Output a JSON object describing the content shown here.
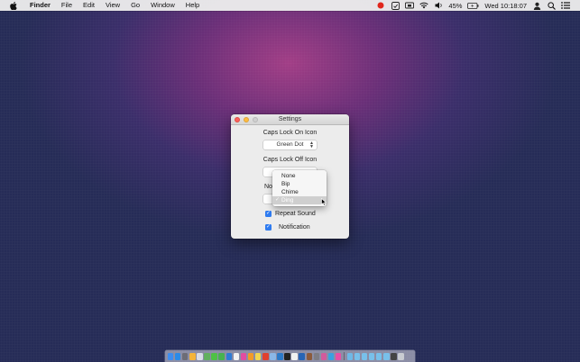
{
  "menubar": {
    "app_name": "Finder",
    "items": [
      "File",
      "Edit",
      "View",
      "Go",
      "Window",
      "Help"
    ],
    "battery": "45%",
    "clock": "Wed 10:18:07",
    "icons": [
      "apple-icon",
      "red-dot-status-icon",
      "caps-lock-status-icon",
      "display-icon",
      "wifi-icon",
      "volume-icon",
      "battery-icon",
      "user-icon",
      "spotlight-icon",
      "notification-center-icon"
    ]
  },
  "window": {
    "title": "Settings",
    "caps_on_label": "Caps Lock On Icon",
    "caps_on_value": "Green Dot",
    "caps_off_label": "Caps Lock Off Icon",
    "partial_label": "No",
    "repeat_sound_label": "Repeat Sound",
    "repeat_sound_checked": true,
    "notification_label": "Notification",
    "notification_checked": true
  },
  "dropdown": {
    "items": [
      "None",
      "Bip",
      "Chime",
      "Ding"
    ],
    "selected": "Ding"
  },
  "colors": {
    "accent": "#2e7bf0",
    "close": "#fc605b",
    "minimize": "#fdbc40"
  },
  "dock": {
    "icons": [
      "finder-icon",
      "appstore-icon",
      "launchpad-icon",
      "photos-icon",
      "mail-icon",
      "maps-icon",
      "messages-icon",
      "facetime-icon",
      "safari-icon",
      "calendar-icon",
      "itunes-icon",
      "ibooks-icon",
      "notes-icon",
      "chrome-icon",
      "preview-icon",
      "xcode-icon",
      "terminal-icon",
      "textedit-icon",
      "sourcetree-icon",
      "dictionary-icon",
      "system-prefs-icon",
      "activity-icon",
      "app-icon-1",
      "app-icon-2",
      "app-icon-3",
      "folder-icon-1",
      "folder-icon-2",
      "folder-icon-3",
      "folder-icon-4",
      "folder-icon-5",
      "downloads-icon",
      "trash-icon"
    ]
  }
}
